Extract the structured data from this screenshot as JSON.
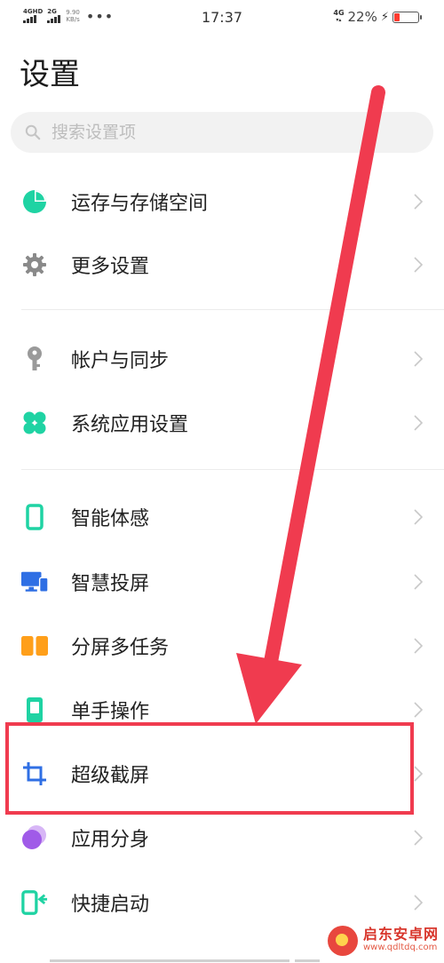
{
  "status": {
    "sim1_label": "4GHD",
    "sim2_label": "2G",
    "speed": "9.90",
    "speed_unit": "KB/s",
    "dots": "•••",
    "time": "17:37",
    "net": "4G",
    "battery_percent": "22%",
    "battery_level": 0.22
  },
  "title": "设置",
  "search": {
    "placeholder": "搜索设置项"
  },
  "items": [
    {
      "label": "运存与存储空间",
      "icon": "storage-pie-icon",
      "color": "#1fd3a3"
    },
    {
      "label": "更多设置",
      "icon": "gear-icon",
      "color": "#8a8a8a"
    },
    {
      "label": "帐户与同步",
      "icon": "key-icon",
      "color": "#9a9a9a"
    },
    {
      "label": "系统应用设置",
      "icon": "clover-icon",
      "color": "#1fd3a3"
    },
    {
      "label": "智能体感",
      "icon": "phone-motion-icon",
      "color": "#1fd3a3"
    },
    {
      "label": "智慧投屏",
      "icon": "screen-cast-icon",
      "color": "#2f6fe4"
    },
    {
      "label": "分屏多任务",
      "icon": "split-screen-icon",
      "color": "#ff9f1a"
    },
    {
      "label": "单手操作",
      "icon": "one-hand-icon",
      "color": "#1fd3a3"
    },
    {
      "label": "超级截屏",
      "icon": "crop-icon",
      "color": "#2f6fe4"
    },
    {
      "label": "应用分身",
      "icon": "app-clone-icon",
      "color": "#a05be8"
    },
    {
      "label": "快捷启动",
      "icon": "quick-launch-icon",
      "color": "#1fd3a3"
    }
  ],
  "colors": {
    "highlight": "#f03b4f"
  },
  "watermark": {
    "name": "启东安卓网",
    "url": "www.qdltdq.com"
  }
}
